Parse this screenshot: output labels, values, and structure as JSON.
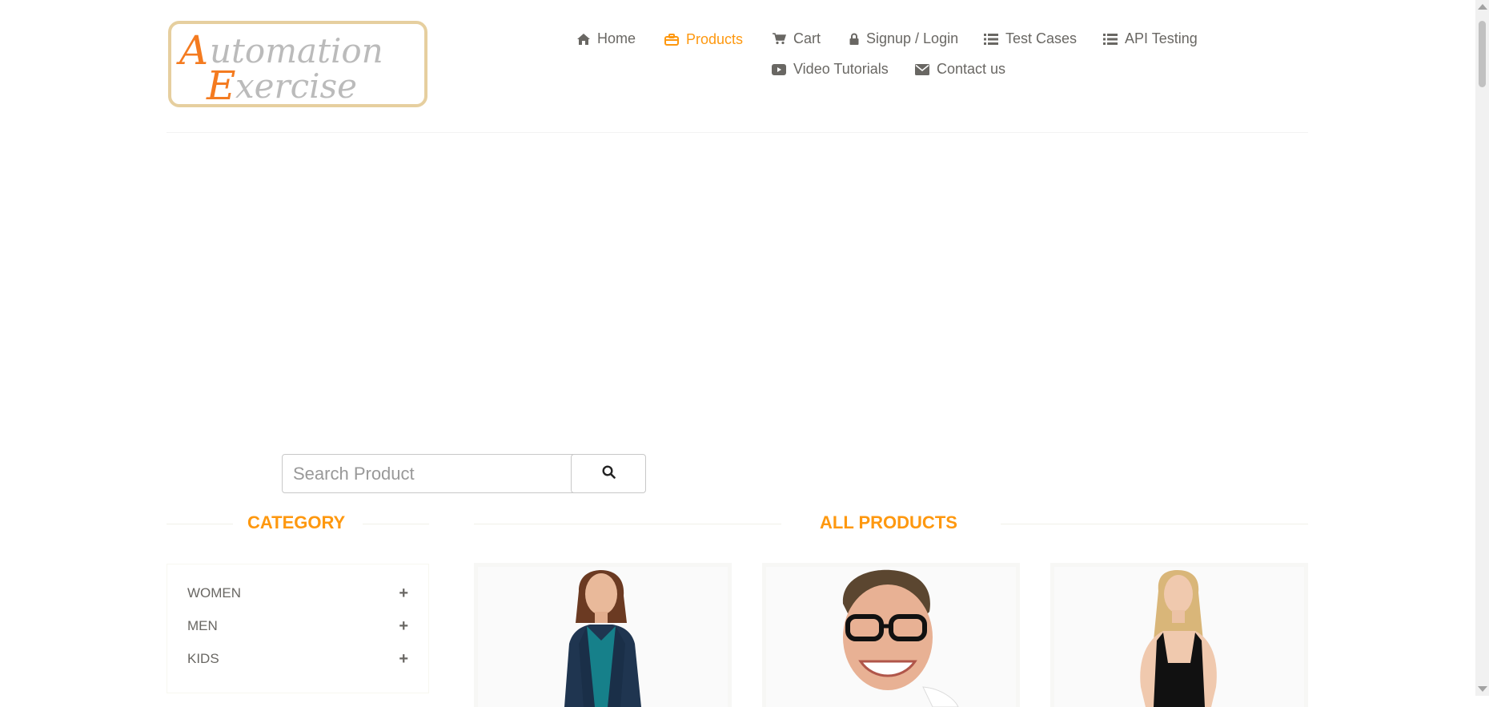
{
  "logo": {
    "line1_initial": "A",
    "line1_rest": "utomation",
    "line2_initial": "E",
    "line2_rest": "xercise",
    "accent_color": "#F47B20",
    "text_color": "#BBBBBB"
  },
  "nav": {
    "home": "Home",
    "products": "Products",
    "cart": "Cart",
    "signup_login": "Signup / Login",
    "test_cases": "Test Cases",
    "api_testing": "API Testing",
    "video_tutorials": "Video Tutorials",
    "contact_us": "Contact us",
    "active_item": "Products",
    "active_color": "#FE980F"
  },
  "search": {
    "placeholder": "Search Product",
    "value": ""
  },
  "category": {
    "title": "CATEGORY",
    "items": [
      {
        "label": "WOMEN",
        "expand": "+"
      },
      {
        "label": "MEN",
        "expand": "+"
      },
      {
        "label": "KIDS",
        "expand": "+"
      }
    ]
  },
  "products": {
    "title": "ALL PRODUCTS",
    "cards": [
      {
        "image": "woman-teal-top-navy-cardigan"
      },
      {
        "image": "smiling-man-black-glasses"
      },
      {
        "image": "woman-black-tank-top"
      }
    ]
  },
  "colors": {
    "accent": "#FE980F",
    "nav_text": "#696763"
  }
}
